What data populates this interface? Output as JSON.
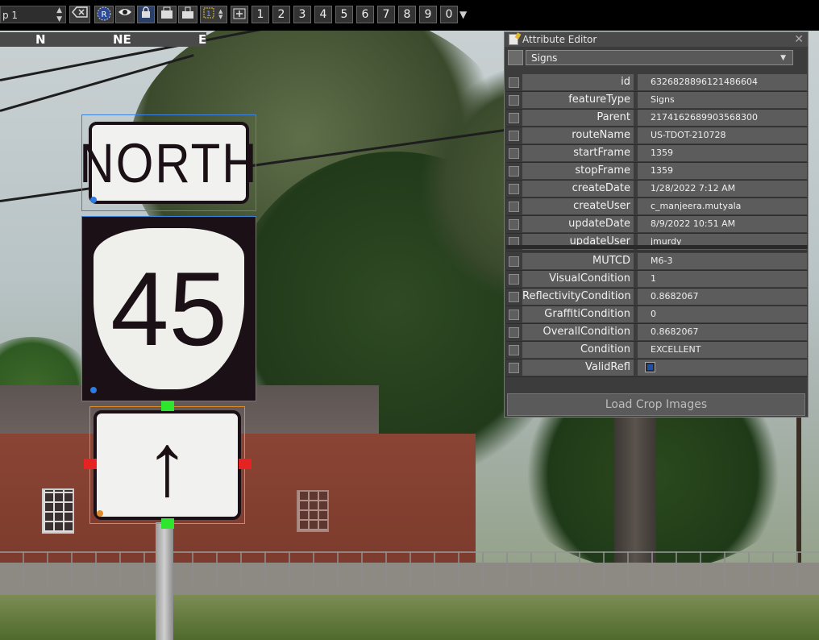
{
  "toolbar": {
    "combo_value": "p 1",
    "page_buttons": [
      "1",
      "2",
      "3",
      "4",
      "5",
      "6",
      "7",
      "8",
      "9",
      "0"
    ],
    "icons": [
      "clear-icon",
      "r-badge-icon",
      "eye-icon",
      "lock-icon",
      "capture-icon",
      "capture-lock-icon",
      "layer-select-icon",
      "add-icon"
    ]
  },
  "compass": {
    "labels": [
      "N",
      "NE",
      "E"
    ]
  },
  "scene": {
    "signs": [
      {
        "text": "NORTH"
      },
      {
        "text": "45"
      },
      {
        "text": "↑"
      }
    ],
    "colors": {
      "selection_blue": "#3a84e0",
      "selection_orange": "#e08a2c",
      "handle_green": "#2ee62e",
      "handle_red": "#e62222"
    }
  },
  "attribute_editor": {
    "title": "Attribute Editor",
    "close": "✕",
    "feature_type": "Signs",
    "group1": [
      {
        "name": "id",
        "value": "6326828896121486604"
      },
      {
        "name": "featureType",
        "value": "Signs"
      },
      {
        "name": "Parent",
        "value": "2174162689903568300"
      },
      {
        "name": "routeName",
        "value": "US-TDOT-210728"
      },
      {
        "name": "startFrame",
        "value": "1359"
      },
      {
        "name": "stopFrame",
        "value": "1359"
      },
      {
        "name": "createDate",
        "value": "1/28/2022 7:12 AM"
      },
      {
        "name": "createUser",
        "value": "c_manjeera.mutyala"
      },
      {
        "name": "updateDate",
        "value": "8/9/2022 10:51 AM"
      },
      {
        "name": "updateUser",
        "value": "jmurdy"
      }
    ],
    "group2": [
      {
        "name": "MUTCD",
        "value": "M6-3"
      },
      {
        "name": "VisualCondition",
        "value": "1"
      },
      {
        "name": "ReflectivityCondition",
        "value": "0.8682067"
      },
      {
        "name": "GraffitiCondition",
        "value": "0"
      },
      {
        "name": "OverallCondition",
        "value": "0.8682067"
      },
      {
        "name": "Condition",
        "value": "EXCELLENT"
      },
      {
        "name": "ValidRefl",
        "value": "",
        "checkbox": true
      }
    ],
    "button_label": "Load Crop Images"
  }
}
